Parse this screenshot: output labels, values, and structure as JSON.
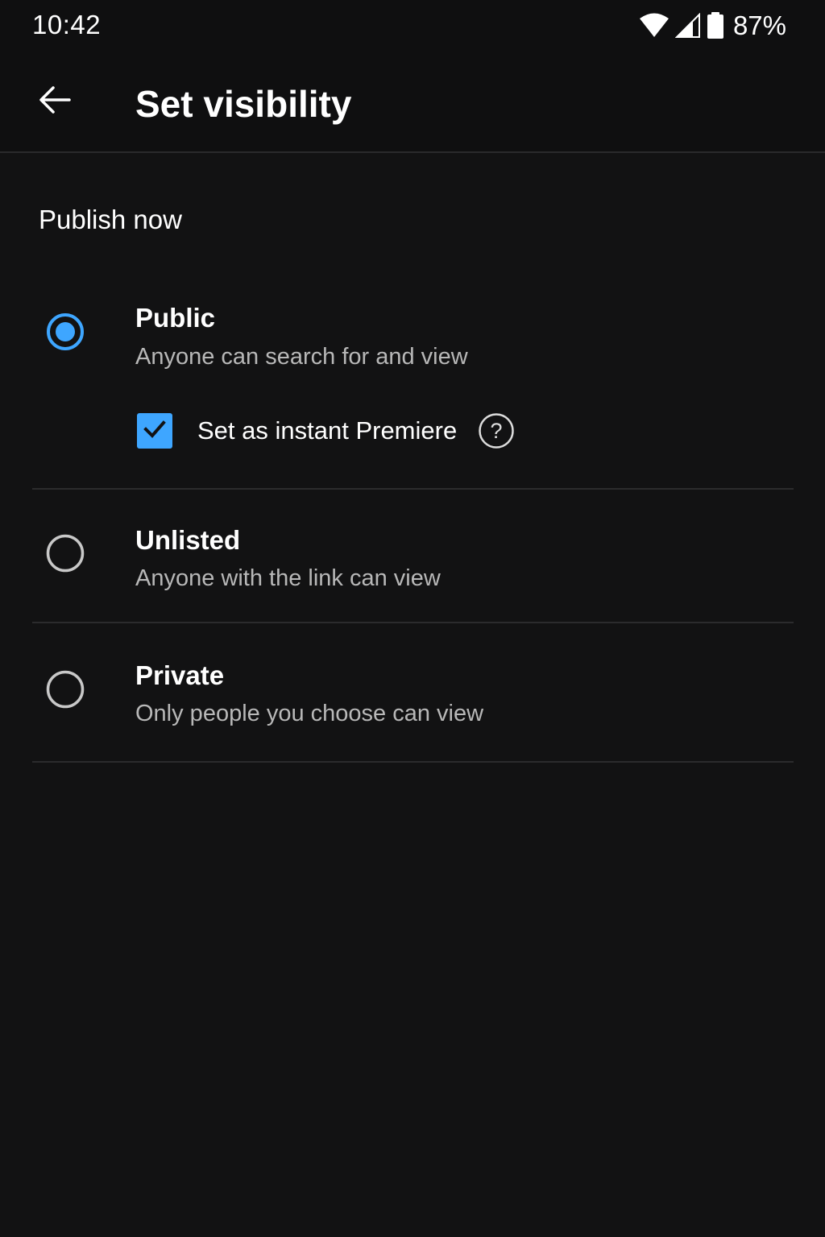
{
  "status_bar": {
    "time": "10:42",
    "battery": "87%",
    "icons": [
      "wifi-icon",
      "signal-icon",
      "battery-icon"
    ]
  },
  "app_bar": {
    "back_icon": "arrow-left-icon",
    "title": "Set visibility"
  },
  "section": {
    "title": "Publish now"
  },
  "options": [
    {
      "label": "Public",
      "description": "Anyone can search for and view",
      "selected": true
    },
    {
      "label": "Unlisted",
      "description": "Anyone with the link can view",
      "selected": false
    },
    {
      "label": "Private",
      "description": "Only people you choose can view",
      "selected": false
    }
  ],
  "premiere": {
    "label": "Set as instant Premiere",
    "checked": true,
    "help_icon": "help-circle-icon"
  },
  "colors": {
    "accent": "#3ea6ff",
    "background": "#121213",
    "secondary_text": "#b8b8b8",
    "divider": "#2b2b2d"
  }
}
